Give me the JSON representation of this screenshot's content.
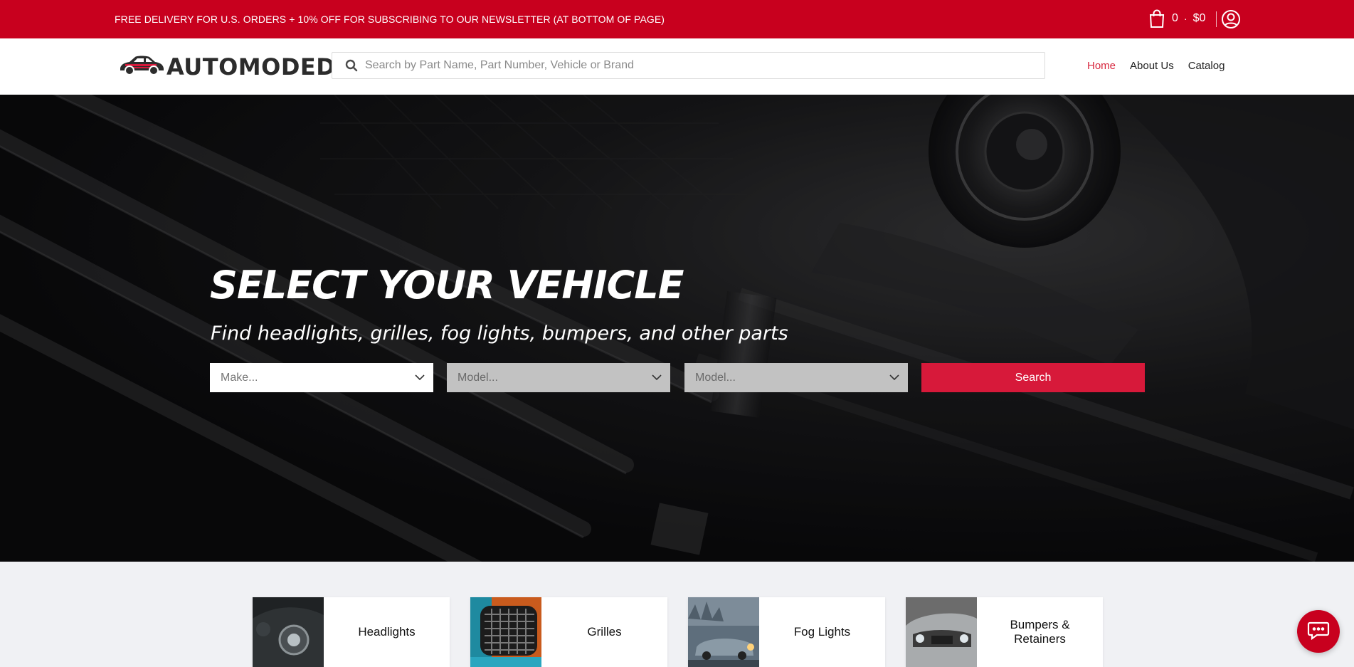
{
  "promo": {
    "text": "FREE DELIVERY FOR U.S. ORDERS + 10% OFF FOR SUBSCRIBING TO OUR NEWSLETTER (AT BOTTOM OF PAGE)"
  },
  "cart": {
    "count": "0",
    "separator": "·",
    "total": "$0",
    "icon": "shopping-bag-icon"
  },
  "account": {
    "icon": "user-circle-icon"
  },
  "header": {
    "logo_text": "AUTOMODED",
    "search_placeholder": "Search by Part Name, Part Number, Vehicle or Brand",
    "nav": [
      {
        "label": "Home",
        "active": true
      },
      {
        "label": "About Us",
        "active": false
      },
      {
        "label": "Catalog",
        "active": false
      }
    ]
  },
  "hero": {
    "title": "SELECT YOUR VEHICLE",
    "subtitle": "Find headlights, grilles, fog lights, bumpers, and other parts",
    "selectors": [
      {
        "placeholder": "Make...",
        "enabled": true
      },
      {
        "placeholder": "Model...",
        "enabled": false
      },
      {
        "placeholder": "Model...",
        "enabled": false
      }
    ],
    "search_button": "Search"
  },
  "categories": [
    {
      "label": "Headlights"
    },
    {
      "label": "Grilles"
    },
    {
      "label": "Fog Lights"
    },
    {
      "label": "Bumpers & Retainers"
    }
  ],
  "colors": {
    "brand_red": "#c8001e",
    "accent_red": "#d7193a",
    "nav_active": "#d7263d"
  },
  "chat": {
    "icon": "chat-bubble-icon"
  }
}
